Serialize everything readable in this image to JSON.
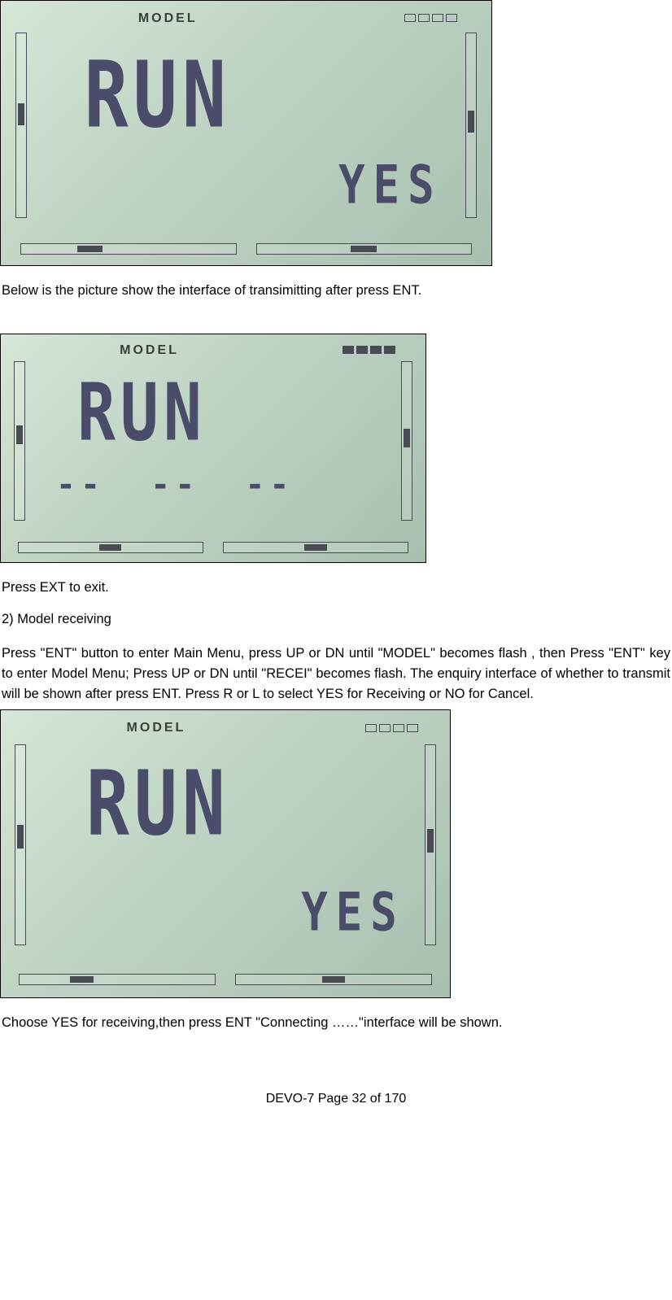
{
  "lcd1": {
    "label": "MODEL",
    "main": "RUN",
    "sub": "YES"
  },
  "text1": "Below is the picture show the interface of transimitting after press ENT.",
  "lcd2": {
    "label": "MODEL",
    "main": "RUN",
    "dashes": "-- -- --"
  },
  "text2": "Press EXT to exit.",
  "heading": "2)   Model receiving",
  "text3": "Press \"ENT\" button to enter Main Menu, press UP or DN until \"MODEL\" becomes flash , then Press \"ENT\" key to enter Model Menu; Press UP or DN until \"RECEI\" becomes flash. The enquiry interface of whether to transmit will be shown after press ENT. Press R or L to select YES for Receiving or NO for Cancel.",
  "lcd3": {
    "label": "MODEL",
    "main": "RUN",
    "sub": "YES"
  },
  "text4": "Choose YES for receiving,then press ENT \"Connecting ……\"interface will be shown.",
  "footer": "DEVO-7     Page 32 of 170"
}
